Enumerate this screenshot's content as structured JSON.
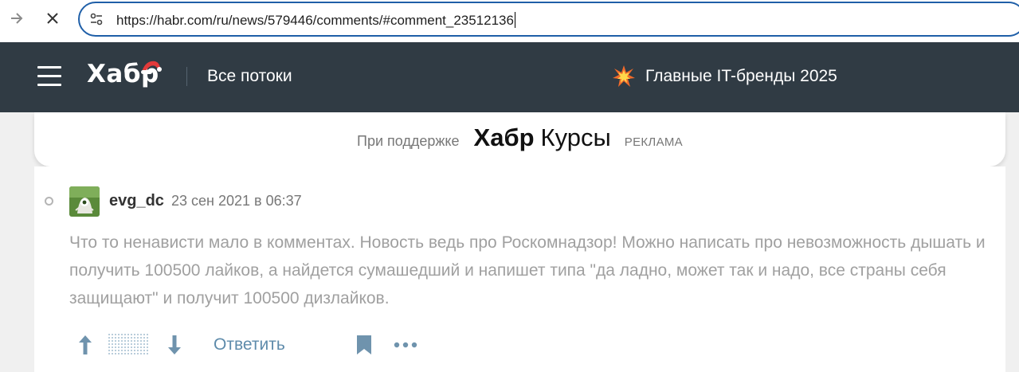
{
  "browser": {
    "url": "https://habr.com/ru/news/579446/comments/#comment_23512136",
    "forward_icon": "arrow-right-icon",
    "stop_icon": "close-icon",
    "site_settings_icon": "tune-icon"
  },
  "header": {
    "logo": "Хабр",
    "flows": "Все потоки",
    "promo": "Главные IT-бренды 2025",
    "bg_color": "#303b44"
  },
  "sponsor": {
    "label": "При поддержке",
    "brand_bold": "Хабр",
    "brand_regular": "Курсы",
    "ad_tag": "РЕКЛАМА"
  },
  "comment": {
    "author": "evg_dc",
    "date": "23 сен 2021 в 06:37",
    "text": "Что то ненависти мало в комментах. Новость ведь про Роскомнадзор! Можно написать про невозможность дышать и получить 100500 лайков, а найдется сумашедший и напишет типа \"да ладно, может так и надо, все страны себя защищают\" и получит 100500 дизлайков.",
    "reply_label": "Ответить",
    "link_color": "#5e8bab"
  }
}
